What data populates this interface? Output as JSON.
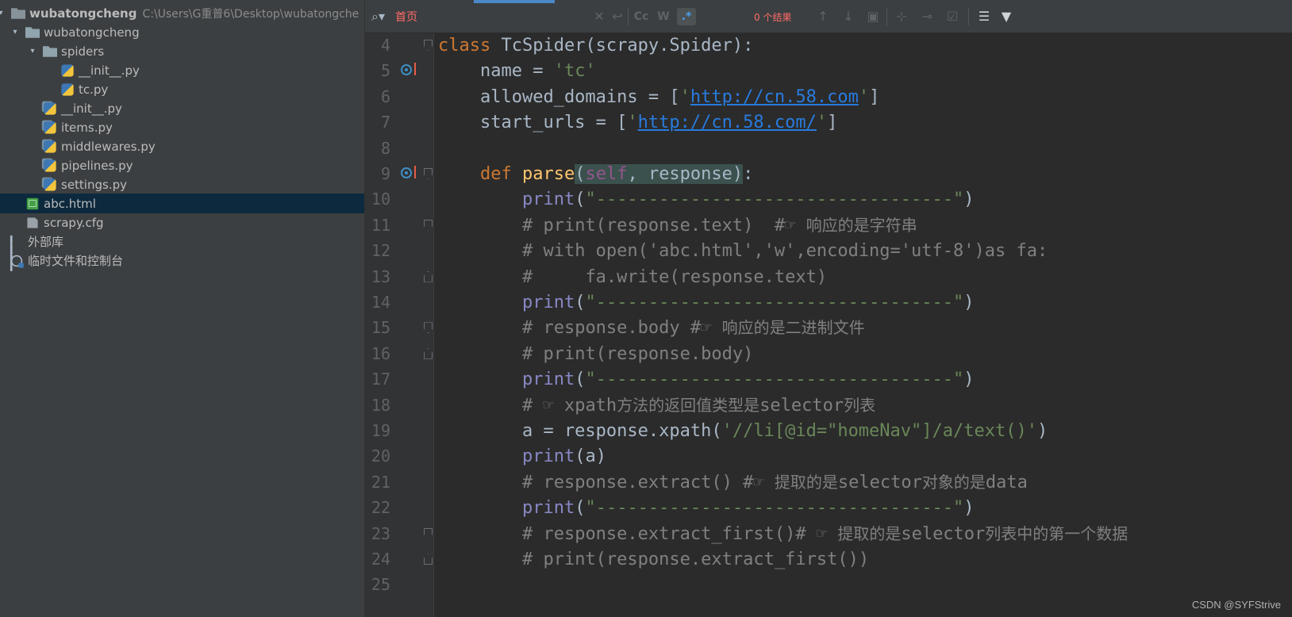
{
  "project": {
    "root": {
      "name": "wubatongcheng",
      "path": "C:\\Users\\G重普6\\Desktop\\wubatongche"
    },
    "tree": [
      {
        "label": "wubatongcheng",
        "indent": 1,
        "icon": "folder-icon",
        "expanded": true
      },
      {
        "label": "spiders",
        "indent": 2,
        "icon": "folder-icon",
        "expanded": true
      },
      {
        "label": "__init__.py",
        "indent": 3,
        "icon": "python-file-icon"
      },
      {
        "label": "tc.py",
        "indent": 3,
        "icon": "python-file-icon"
      },
      {
        "label": "__init__.py",
        "indent": 2,
        "icon": "python-file-icon"
      },
      {
        "label": "items.py",
        "indent": 2,
        "icon": "python-file-icon"
      },
      {
        "label": "middlewares.py",
        "indent": 2,
        "icon": "python-file-icon"
      },
      {
        "label": "pipelines.py",
        "indent": 2,
        "icon": "python-file-icon"
      },
      {
        "label": "settings.py",
        "indent": 2,
        "icon": "python-file-icon"
      },
      {
        "label": "abc.html",
        "indent": 1,
        "icon": "html-file-icon",
        "selected": true
      },
      {
        "label": "scrapy.cfg",
        "indent": 1,
        "icon": "config-file-icon"
      }
    ],
    "external_libraries": "外部库",
    "scratches": "临时文件和控制台"
  },
  "find": {
    "query": "首页",
    "match_case": "Cc",
    "words": "W",
    "regex": ".*",
    "results": "0 个结果"
  },
  "colors": {
    "background": "#2b2b2b",
    "sidebar": "#3c3f41",
    "selection": "#0d293e",
    "keyword": "#cc7832",
    "string": "#6a8759",
    "comment": "#808080"
  },
  "editor": {
    "lines": [
      {
        "n": "4",
        "code": "class TcSpider(scrapy.Spider):"
      },
      {
        "n": "5",
        "code": "    name = 'tc'"
      },
      {
        "n": "6",
        "code": "    allowed_domains = ['http://cn.58.com']"
      },
      {
        "n": "7",
        "code": "    start_urls = ['http://cn.58.com/']"
      },
      {
        "n": "8",
        "code": ""
      },
      {
        "n": "9",
        "code": "    def parse(self, response):"
      },
      {
        "n": "10",
        "code": "        print(\"----------------------------------\")"
      },
      {
        "n": "11",
        "code": "        # print(response.text)  #☞ 响应的是字符串"
      },
      {
        "n": "12",
        "code": "        # with open('abc.html','w',encoding='utf-8')as fa:"
      },
      {
        "n": "13",
        "code": "        #     fa.write(response.text)"
      },
      {
        "n": "14",
        "code": "        print(\"----------------------------------\")"
      },
      {
        "n": "15",
        "code": "        # response.body #☞ 响应的是二进制文件"
      },
      {
        "n": "16",
        "code": "        # print(response.body)"
      },
      {
        "n": "17",
        "code": "        print(\"----------------------------------\")"
      },
      {
        "n": "18",
        "code": "        # ☞ xpath方法的返回值类型是selector列表"
      },
      {
        "n": "19",
        "code": "        a = response.xpath('//li[@id=\"homeNav\"]/a/text()')"
      },
      {
        "n": "20",
        "code": "        print(a)"
      },
      {
        "n": "21",
        "code": "        # response.extract() #☞ 提取的是selector对象的是data"
      },
      {
        "n": "22",
        "code": "        print(\"----------------------------------\")"
      },
      {
        "n": "23",
        "code": "        # response.extract_first()# ☞ 提取的是selector列表中的第一个数据"
      },
      {
        "n": "24",
        "code": "        # print(response.extract_first())"
      },
      {
        "n": "25",
        "code": ""
      }
    ]
  },
  "watermark": "CSDN @SYFStrive"
}
